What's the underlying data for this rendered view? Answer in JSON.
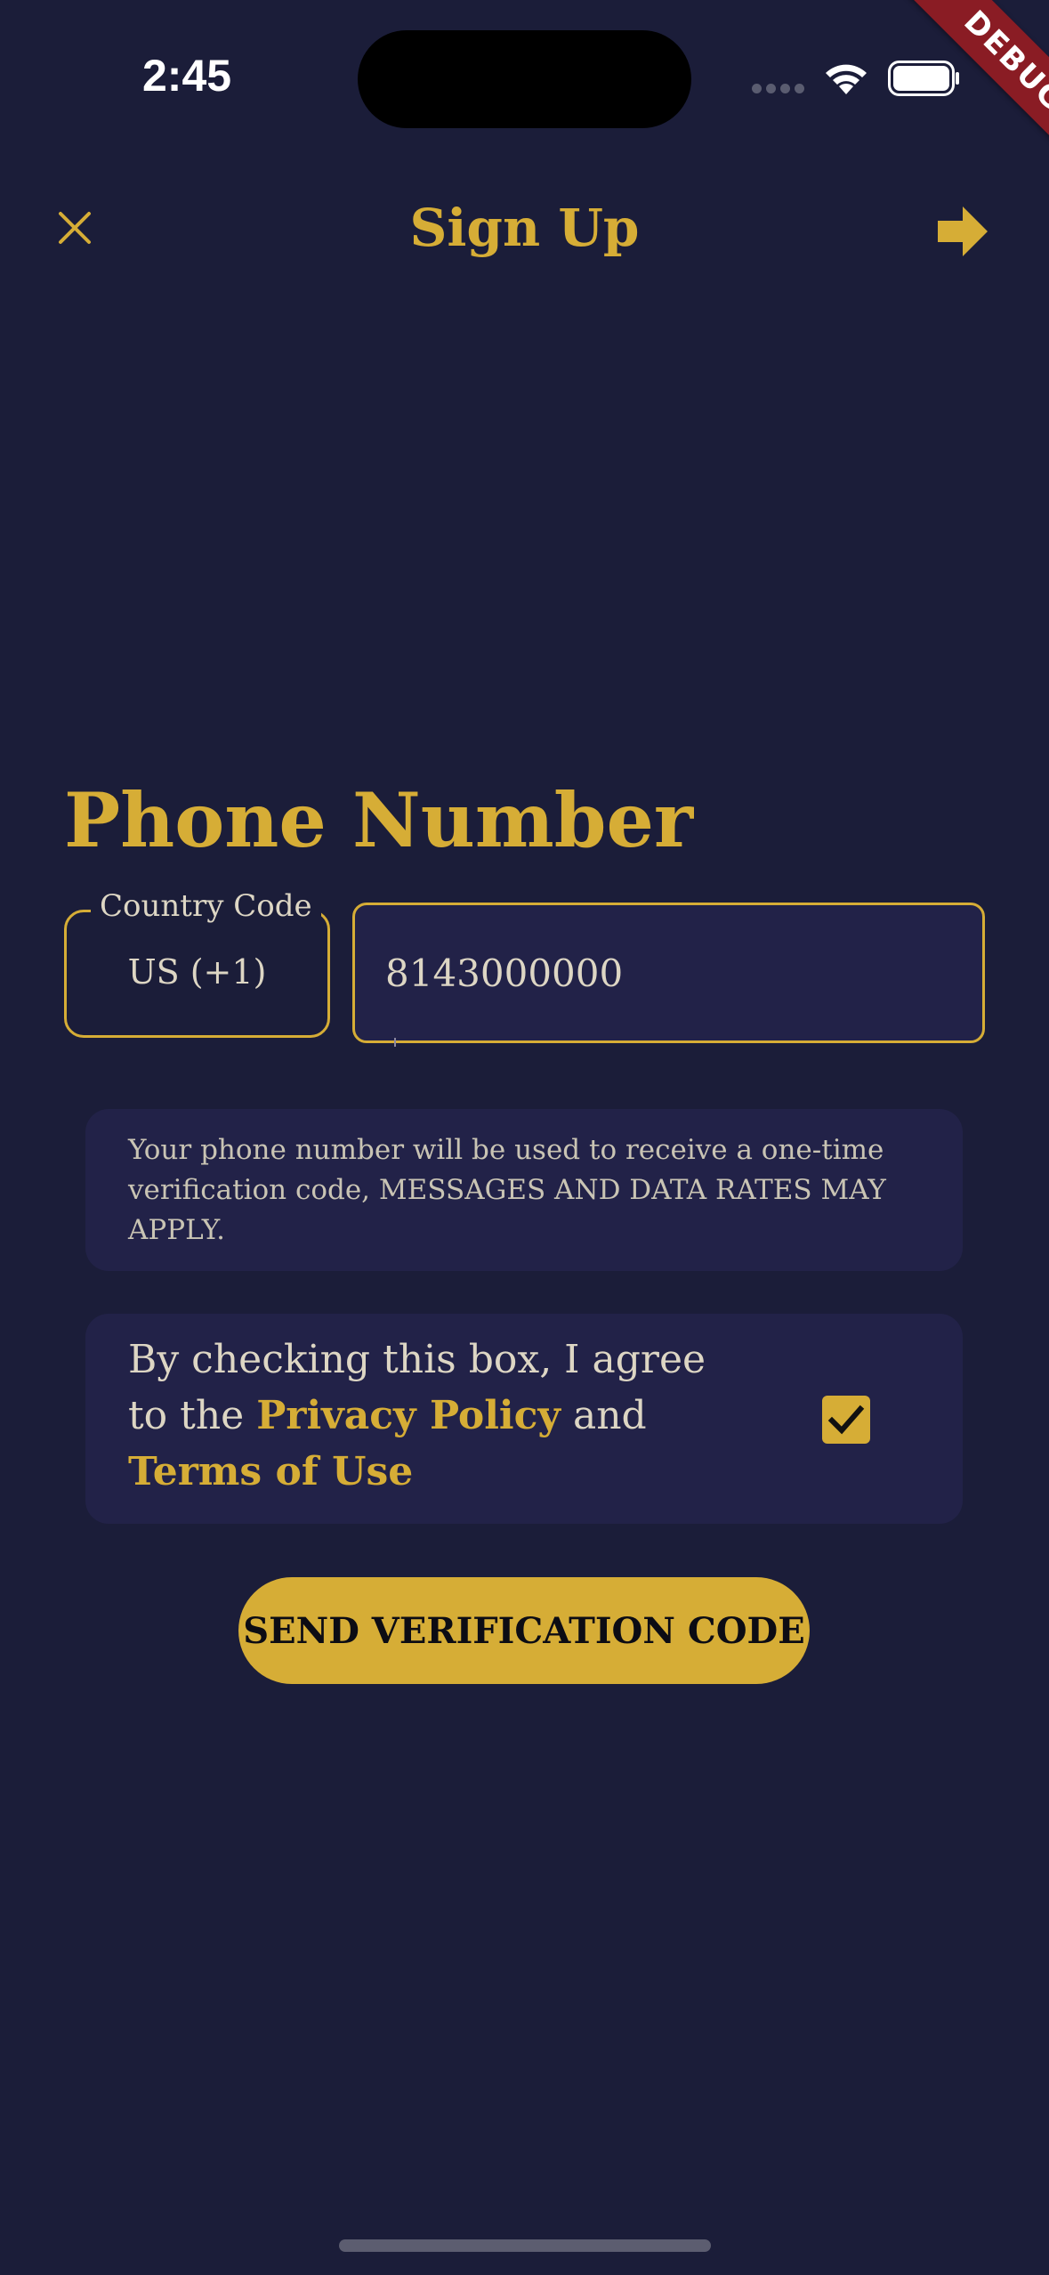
{
  "status_bar": {
    "time": "2:45",
    "debug_label": "DEBUG"
  },
  "header": {
    "title": "Sign Up",
    "close_icon": "close-icon",
    "next_icon": "arrow-right-icon"
  },
  "form": {
    "section_title": "Phone Number",
    "country_code": {
      "label": "Country Code",
      "value": "US (+1)"
    },
    "phone": {
      "value": "8143000000"
    },
    "info_text": "Your phone number will be used to receive a one-time verification code, MESSAGES AND DATA RATES MAY APPLY.",
    "consent": {
      "prefix": "By checking this box, I agree to the ",
      "privacy_link": "Privacy Policy",
      "middle": " and ",
      "terms_link": "Terms of Use",
      "checked": true
    },
    "send_button": "SEND VERIFICATION CODE"
  },
  "colors": {
    "background": "#1b1d39",
    "card": "#222248",
    "accent": "#d6ad36",
    "text": "#ddd6c4"
  }
}
